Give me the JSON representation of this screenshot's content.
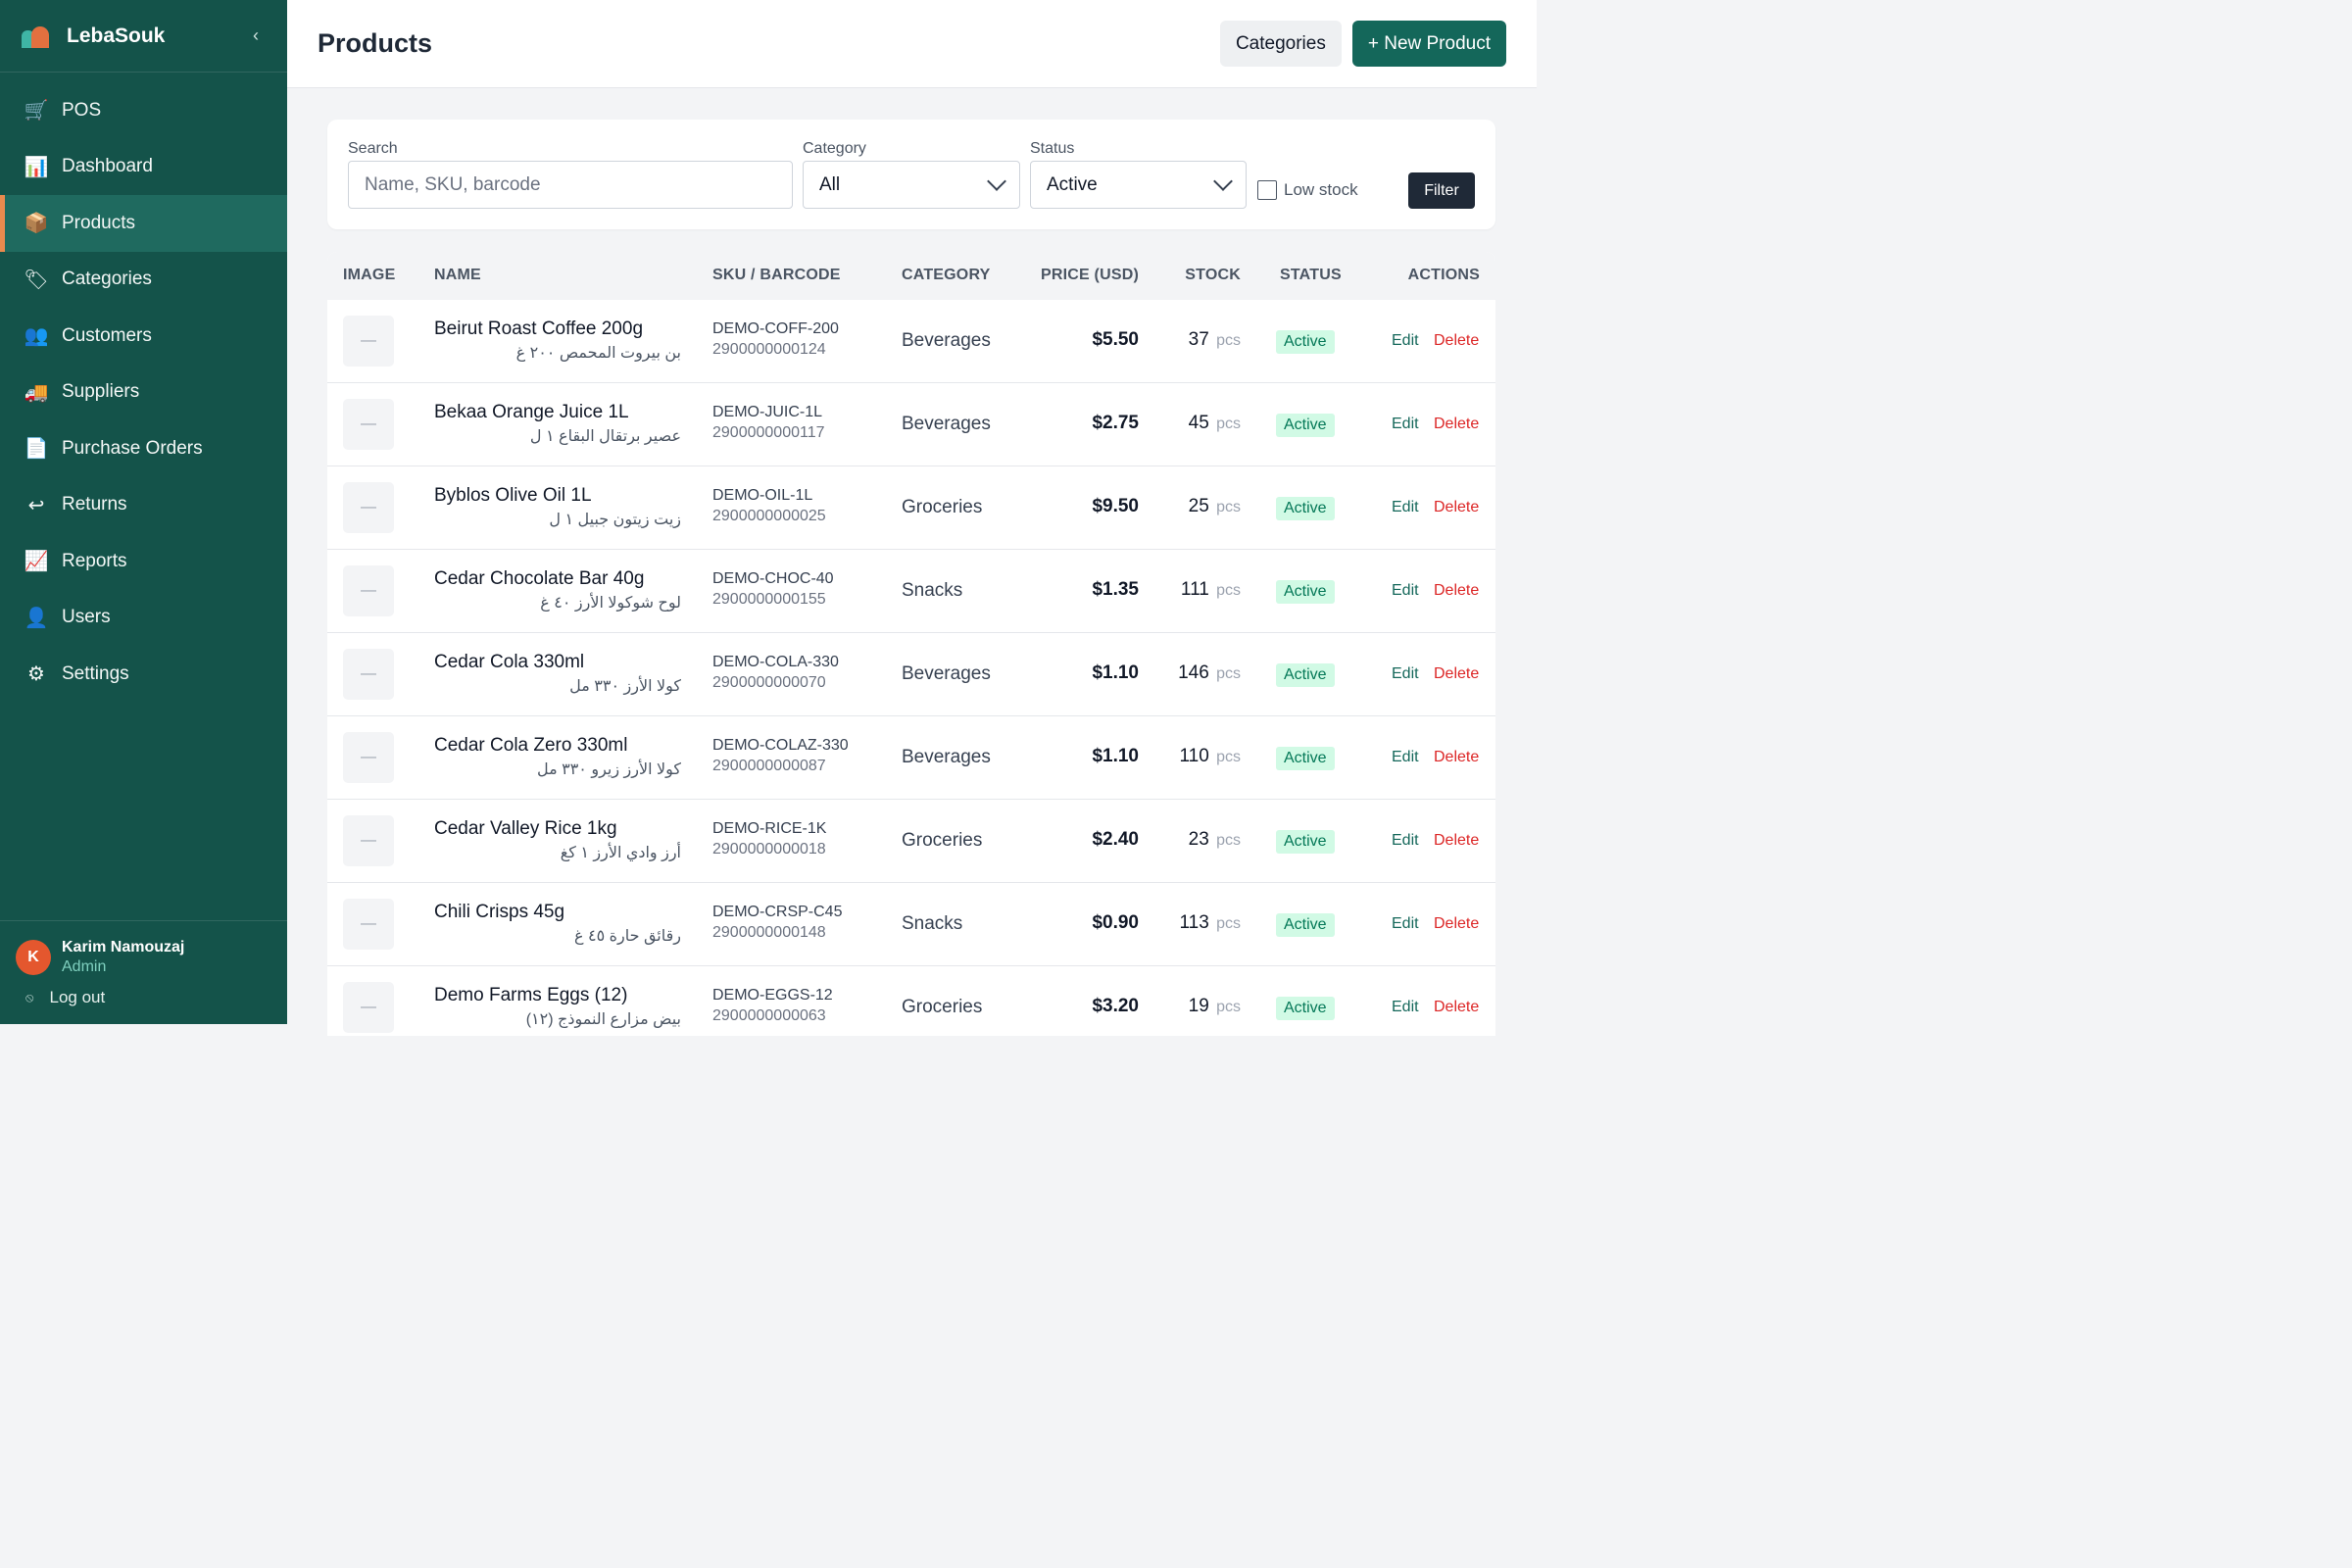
{
  "app": {
    "name": "LebaSouk",
    "collapse_icon": "chevron-left-icon"
  },
  "sidebar": {
    "items": [
      {
        "label": "POS",
        "icon": "cash-register-icon",
        "glyph": "🛒"
      },
      {
        "label": "Dashboard",
        "icon": "bar-chart-icon",
        "glyph": "📊"
      },
      {
        "label": "Products",
        "icon": "package-icon",
        "glyph": "📦",
        "active": true
      },
      {
        "label": "Categories",
        "icon": "tag-icon",
        "glyph": "🏷"
      },
      {
        "label": "Customers",
        "icon": "people-icon",
        "glyph": "👥"
      },
      {
        "label": "Suppliers",
        "icon": "truck-icon",
        "glyph": "🚚"
      },
      {
        "label": "Purchase Orders",
        "icon": "document-icon",
        "glyph": "📄"
      },
      {
        "label": "Returns",
        "icon": "return-arrow-icon",
        "glyph": "↩"
      },
      {
        "label": "Reports",
        "icon": "line-chart-icon",
        "glyph": "📈"
      },
      {
        "label": "Users",
        "icon": "user-icon",
        "glyph": "👤"
      },
      {
        "label": "Settings",
        "icon": "gear-icon",
        "glyph": "⚙"
      }
    ],
    "user": {
      "initial": "K",
      "name": "Karim Namouzaj",
      "role": "Admin"
    },
    "logout_label": "Log out"
  },
  "header": {
    "title": "Products",
    "categories_button": "Categories",
    "new_product_button": "+ New Product"
  },
  "filters": {
    "search_label": "Search",
    "search_placeholder": "Name, SKU, barcode",
    "category_label": "Category",
    "category_value": "All",
    "status_label": "Status",
    "status_value": "Active",
    "low_stock_label": "Low stock",
    "filter_button": "Filter"
  },
  "table": {
    "columns": [
      "IMAGE",
      "NAME",
      "SKU / BARCODE",
      "CATEGORY",
      "PRICE (USD)",
      "STOCK",
      "STATUS",
      "ACTIONS"
    ],
    "edit_label": "Edit",
    "delete_label": "Delete",
    "image_placeholder": "—",
    "rows": [
      {
        "name": "Beirut Roast Coffee 200g",
        "name_ar": "بن بيروت المحمص ٢٠٠ غ",
        "sku": "DEMO-COFF-200",
        "barcode": "2900000000124",
        "category": "Beverages",
        "price": "$5.50",
        "stock": "37",
        "unit": "pcs",
        "status": "Active"
      },
      {
        "name": "Bekaa Orange Juice 1L",
        "name_ar": "عصير برتقال البقاع ١ ل",
        "sku": "DEMO-JUIC-1L",
        "barcode": "2900000000117",
        "category": "Beverages",
        "price": "$2.75",
        "stock": "45",
        "unit": "pcs",
        "status": "Active"
      },
      {
        "name": "Byblos Olive Oil 1L",
        "name_ar": "زيت زيتون جبيل ١ ل",
        "sku": "DEMO-OIL-1L",
        "barcode": "2900000000025",
        "category": "Groceries",
        "price": "$9.50",
        "stock": "25",
        "unit": "pcs",
        "status": "Active"
      },
      {
        "name": "Cedar Chocolate Bar 40g",
        "name_ar": "لوح شوكولا الأرز ٤٠ غ",
        "sku": "DEMO-CHOC-40",
        "barcode": "2900000000155",
        "category": "Snacks",
        "price": "$1.35",
        "stock": "111",
        "unit": "pcs",
        "status": "Active"
      },
      {
        "name": "Cedar Cola 330ml",
        "name_ar": "كولا الأرز ٣٣٠ مل",
        "sku": "DEMO-COLA-330",
        "barcode": "2900000000070",
        "category": "Beverages",
        "price": "$1.10",
        "stock": "146",
        "unit": "pcs",
        "status": "Active"
      },
      {
        "name": "Cedar Cola Zero 330ml",
        "name_ar": "كولا الأرز زيرو ٣٣٠ مل",
        "sku": "DEMO-COLAZ-330",
        "barcode": "2900000000087",
        "category": "Beverages",
        "price": "$1.10",
        "stock": "110",
        "unit": "pcs",
        "status": "Active"
      },
      {
        "name": "Cedar Valley Rice 1kg",
        "name_ar": "أرز وادي الأرز ١ كغ",
        "sku": "DEMO-RICE-1K",
        "barcode": "2900000000018",
        "category": "Groceries",
        "price": "$2.40",
        "stock": "23",
        "unit": "pcs",
        "status": "Active"
      },
      {
        "name": "Chili Crisps 45g",
        "name_ar": "رقائق حارة ٤٥ غ",
        "sku": "DEMO-CRSP-C45",
        "barcode": "2900000000148",
        "category": "Snacks",
        "price": "$0.90",
        "stock": "113",
        "unit": "pcs",
        "status": "Active"
      },
      {
        "name": "Demo Farms Eggs (12)",
        "name_ar": "بيض مزارع النموذج (١٢)",
        "sku": "DEMO-EGGS-12",
        "barcode": "2900000000063",
        "category": "Groceries",
        "price": "$3.20",
        "stock": "19",
        "unit": "pcs",
        "status": "Active"
      }
    ]
  }
}
